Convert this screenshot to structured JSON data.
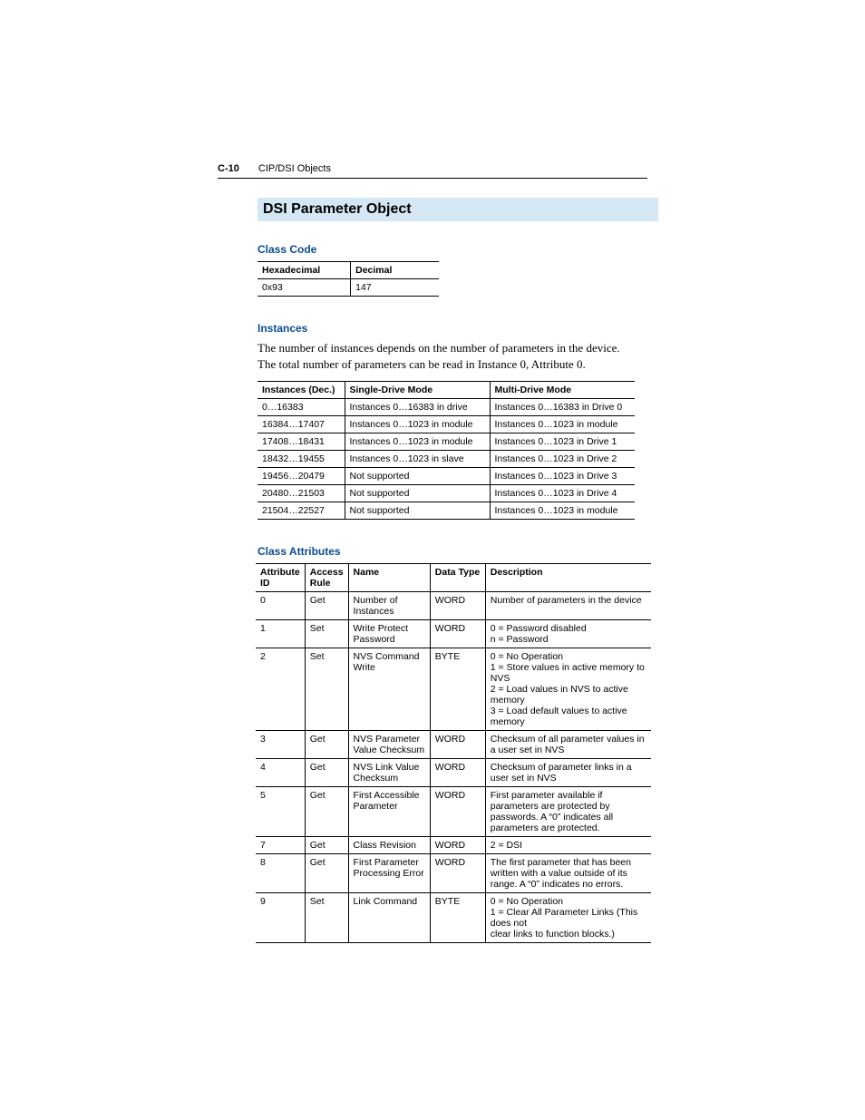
{
  "header": {
    "page_label": "C-10",
    "chapter_title": "CIP/DSI Objects"
  },
  "section_title": "DSI Parameter Object",
  "class_code": {
    "heading": "Class Code",
    "headers": [
      "Hexadecimal",
      "Decimal"
    ],
    "row": [
      "0x93",
      "147"
    ]
  },
  "instances": {
    "heading": "Instances",
    "body": "The number of instances depends on the number of parameters in the device. The total number of parameters can be read in Instance 0, Attribute 0.",
    "headers": [
      "Instances (Dec.)",
      "Single-Drive Mode",
      "Multi-Drive Mode"
    ],
    "rows": [
      [
        "0…16383",
        "Instances 0…16383 in drive",
        "Instances 0…16383 in Drive 0"
      ],
      [
        "16384…17407",
        "Instances 0…1023 in module",
        "Instances 0…1023 in module"
      ],
      [
        "17408…18431",
        "Instances 0…1023 in module",
        "Instances 0…1023 in Drive 1"
      ],
      [
        "18432…19455",
        "Instances 0…1023 in slave",
        "Instances 0…1023 in Drive 2"
      ],
      [
        "19456…20479",
        "Not supported",
        "Instances 0…1023 in Drive 3"
      ],
      [
        "20480…21503",
        "Not supported",
        "Instances 0…1023 in Drive 4"
      ],
      [
        "21504…22527",
        "Not supported",
        "Instances 0…1023 in module"
      ]
    ]
  },
  "class_attributes": {
    "heading": "Class Attributes",
    "headers": [
      "Attribute ID",
      "Access Rule",
      "Name",
      "Data Type",
      "Description"
    ],
    "rows": [
      {
        "id": "0",
        "access": "Get",
        "name": "Number of Instances",
        "dtype": "WORD",
        "desc": "Number of parameters in the device"
      },
      {
        "id": "1",
        "access": "Set",
        "name": "Write Protect Password",
        "dtype": "WORD",
        "desc": "0 = Password disabled\nn = Password"
      },
      {
        "id": "2",
        "access": "Set",
        "name": "NVS Command Write",
        "dtype": "BYTE",
        "desc": "0 = No Operation\n1 = Store values in active memory to NVS\n2 = Load values in NVS to active memory\n3 = Load default values to active memory"
      },
      {
        "id": "3",
        "access": "Get",
        "name": "NVS Parameter Value Checksum",
        "dtype": "WORD",
        "desc": "Checksum of all parameter values in a user set in NVS"
      },
      {
        "id": "4",
        "access": "Get",
        "name": "NVS Link Value Checksum",
        "dtype": "WORD",
        "desc": "Checksum of parameter links in a user set in NVS"
      },
      {
        "id": "5",
        "access": "Get",
        "name": "First Accessible Parameter",
        "dtype": "WORD",
        "desc": "First parameter available if parameters are protected by passwords. A “0” indicates all parameters are protected."
      },
      {
        "id": "7",
        "access": "Get",
        "name": "Class Revision",
        "dtype": "WORD",
        "desc": "2 = DSI"
      },
      {
        "id": "8",
        "access": "Get",
        "name": "First Parameter Processing Error",
        "dtype": "WORD",
        "desc": "The first parameter that has been written with a value outside of its range. A “0” indicates no errors."
      },
      {
        "id": "9",
        "access": "Set",
        "name": "Link Command",
        "dtype": "BYTE",
        "desc": "0 = No Operation\n1 = Clear All Parameter Links (This does not\n       clear links to function blocks.)"
      }
    ]
  }
}
